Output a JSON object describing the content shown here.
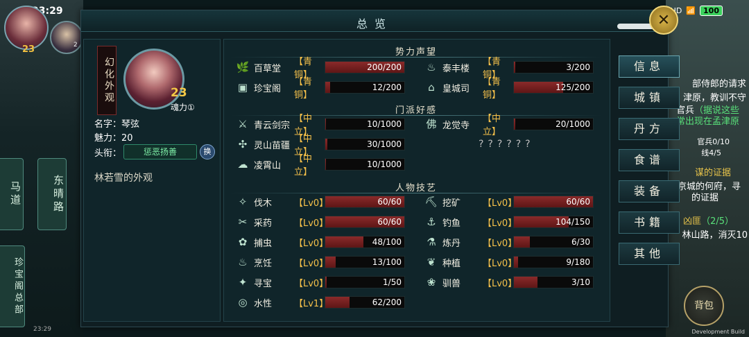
{
  "status": {
    "time": "23:29",
    "battery": "100",
    "signal": "HD"
  },
  "hud": {
    "level_main": "23",
    "level_secondary": "2"
  },
  "map": {
    "node_left": "马道",
    "node_dongqing": "东晴路",
    "node_zhenbao": "珍宝阁总部"
  },
  "right_quests": {
    "line1": "部侍郎的请求",
    "line2": "津原，教训不守",
    "line3a": "官兵",
    "line3b": "（据说这些",
    "line4": "常出现在孟津原",
    "line5": "官兵0/10",
    "line6": "线4/5",
    "line7": "谋的证据",
    "line8": "京城的何府，寻",
    "line9": "的证据",
    "line10a": "凶匪",
    "line10b": "（2/5）",
    "line11": "林山路，消灭10"
  },
  "modal": {
    "title": "总览",
    "close": "✕"
  },
  "profile": {
    "banner": "幻化外观",
    "level": "23",
    "soul_label": "魂力①",
    "name_line": "名字：琴弦",
    "charm_line": "魅力：20",
    "title_label": "头衔：",
    "title_value": "惩恶扬善",
    "title_swap": "换",
    "appearance": "林若雪的外观"
  },
  "sections": {
    "reputation": "势力声望",
    "sect": "门派好感",
    "skills": "人物技艺"
  },
  "reputation": [
    {
      "icon": "leaf-icon",
      "glyph": "🌿",
      "name": "百草堂",
      "tier": "【青铜】",
      "value": "200/200",
      "fill": 1.0
    },
    {
      "icon": "pot-icon",
      "glyph": "♨",
      "name": "泰丰楼",
      "tier": "【青铜】",
      "value": "3/200",
      "fill": 0.015
    },
    {
      "icon": "chest-icon",
      "glyph": "▣",
      "name": "珍宝阁",
      "tier": "【青铜】",
      "value": "12/200",
      "fill": 0.06
    },
    {
      "icon": "palace-icon",
      "glyph": "⌂",
      "name": "皇城司",
      "tier": "【青铜】",
      "value": "125/200",
      "fill": 0.625
    }
  ],
  "sect": [
    {
      "icon": "sword-icon",
      "glyph": "⚔",
      "name": "青云剑宗",
      "tier": "【中立】",
      "value": "10/1000",
      "fill": 0.01
    },
    {
      "icon": "buddha-icon",
      "glyph": "佛",
      "name": "龙觉寺",
      "tier": "【中立】",
      "value": "20/1000",
      "fill": 0.02
    },
    {
      "icon": "butterfly-icon",
      "glyph": "✣",
      "name": "灵山苗疆",
      "tier": "【中立】",
      "value": "30/1000",
      "fill": 0.03
    },
    {
      "icon": "cloud-icon",
      "glyph": "☁",
      "name": "凌霄山",
      "tier": "【中立】",
      "value": "10/1000",
      "fill": 0.01
    }
  ],
  "sect_unknown": "??????",
  "skills": [
    {
      "icon": "axe-icon",
      "glyph": "✧",
      "name": "伐木",
      "tier": "【Lv0】",
      "value": "60/60",
      "fill": 1.0
    },
    {
      "icon": "pickaxe-icon",
      "glyph": "⛏",
      "name": "挖矿",
      "tier": "【Lv0】",
      "value": "60/60",
      "fill": 1.0
    },
    {
      "icon": "herb-icon",
      "glyph": "✂",
      "name": "采药",
      "tier": "【Lv0】",
      "value": "60/60",
      "fill": 1.0
    },
    {
      "icon": "fishing-icon",
      "glyph": "⚓",
      "name": "钓鱼",
      "tier": "【Lv0】",
      "value": "104/150",
      "fill": 0.693
    },
    {
      "icon": "net-icon",
      "glyph": "✿",
      "name": "捕虫",
      "tier": "【Lv0】",
      "value": "48/100",
      "fill": 0.48
    },
    {
      "icon": "alchemy-icon",
      "glyph": "⚗",
      "name": "炼丹",
      "tier": "【Lv0】",
      "value": "6/30",
      "fill": 0.2
    },
    {
      "icon": "cooking-icon",
      "glyph": "♨",
      "name": "烹饪",
      "tier": "【Lv0】",
      "value": "13/100",
      "fill": 0.13
    },
    {
      "icon": "sprout-icon",
      "glyph": "❦",
      "name": "种植",
      "tier": "【Lv0】",
      "value": "9/180",
      "fill": 0.05
    },
    {
      "icon": "treasure-icon",
      "glyph": "✦",
      "name": "寻宝",
      "tier": "【Lv0】",
      "value": "1/50",
      "fill": 0.02
    },
    {
      "icon": "paw-icon",
      "glyph": "❀",
      "name": "驯兽",
      "tier": "【Lv0】",
      "value": "3/10",
      "fill": 0.3
    },
    {
      "icon": "water-icon",
      "glyph": "◎",
      "name": "水性",
      "tier": "【Lv1】",
      "value": "62/200",
      "fill": 0.31
    }
  ],
  "nav": [
    "信息",
    "城镇",
    "丹方",
    "食谱",
    "装备",
    "书籍",
    "其他"
  ],
  "bag": "背包",
  "footer": {
    "time": "23:29",
    "dev": "Development Build"
  }
}
